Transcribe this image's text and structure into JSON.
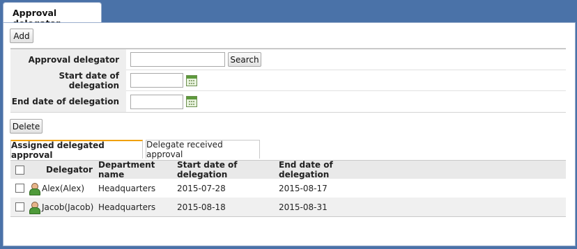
{
  "window": {
    "tab_title": "Approval delegator"
  },
  "toolbar": {
    "add_label": "Add",
    "delete_label": "Delete"
  },
  "form": {
    "delegator_label": "Approval delegator",
    "delegator_value": "",
    "search_label": "Search",
    "start_label": "Start date of delegation",
    "start_value": "",
    "end_label": "End date of delegation",
    "end_value": ""
  },
  "tabs": {
    "assigned": "Assigned delegated approval",
    "received": "Delegate received approval"
  },
  "grid": {
    "columns": {
      "delegator": "Delegator",
      "department": "Department name",
      "start": "Start date of delegation",
      "end": "End date of delegation"
    },
    "rows": [
      {
        "delegator": "Alex(Alex)",
        "department": "Headquarters",
        "start": "2015-07-28",
        "end": "2015-08-17"
      },
      {
        "delegator": "Jacob(Jacob)",
        "department": "Headquarters",
        "start": "2015-08-18",
        "end": "2015-08-31"
      }
    ]
  },
  "colors": {
    "background": "#4a72a8",
    "active_tab_accent": "#f0a000",
    "header_bg": "#e9e9e9"
  },
  "icons": [
    "calendar-icon",
    "person-icon"
  ]
}
